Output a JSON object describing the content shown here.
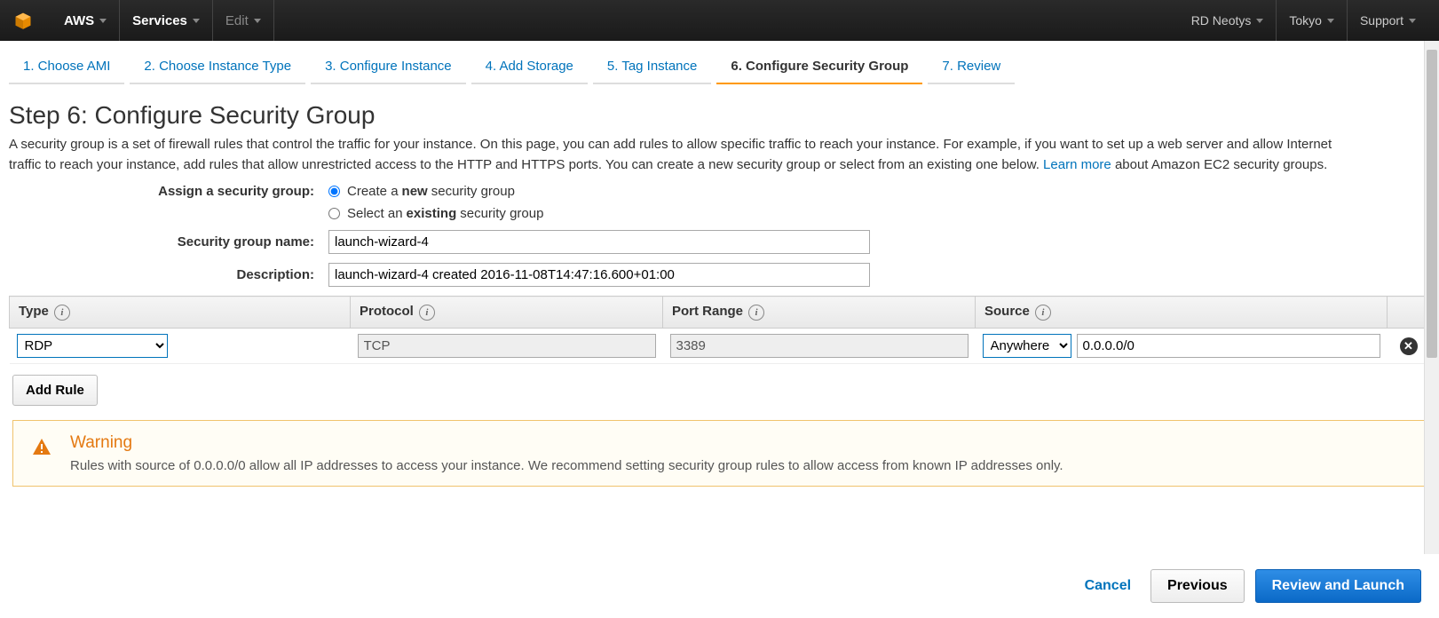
{
  "topnav": {
    "aws": "AWS",
    "services": "Services",
    "edit": "Edit",
    "account": "RD Neotys",
    "region": "Tokyo",
    "support": "Support"
  },
  "wizard": {
    "tabs": [
      "1. Choose AMI",
      "2. Choose Instance Type",
      "3. Configure Instance",
      "4. Add Storage",
      "5. Tag Instance",
      "6. Configure Security Group",
      "7. Review"
    ]
  },
  "page": {
    "title": "Step 6: Configure Security Group",
    "desc_pre": "A security group is a set of firewall rules that control the traffic for your instance. On this page, you can add rules to allow specific traffic to reach your instance. For example, if you want to set up a web server and allow Internet traffic to reach your instance, add rules that allow unrestricted access to the HTTP and HTTPS ports. You can create a new security group or select from an existing one below. ",
    "learn_more": "Learn more",
    "desc_post": " about Amazon EC2 security groups."
  },
  "form": {
    "assign_label": "Assign a security group:",
    "option_new_pre": "Create a ",
    "option_new_bold": "new",
    "option_new_post": " security group",
    "option_existing_pre": "Select an ",
    "option_existing_bold": "existing",
    "option_existing_post": " security group",
    "name_label": "Security group name:",
    "name_value": "launch-wizard-4",
    "desc_label": "Description:",
    "desc_value": "launch-wizard-4 created 2016-11-08T14:47:16.600+01:00"
  },
  "table": {
    "headers": {
      "type": "Type",
      "protocol": "Protocol",
      "port": "Port Range",
      "source": "Source"
    },
    "rows": [
      {
        "type": "RDP",
        "protocol": "TCP",
        "port": "3389",
        "source_opt": "Anywhere",
        "source_ip": "0.0.0.0/0"
      }
    ],
    "add_rule": "Add Rule"
  },
  "warning": {
    "title": "Warning",
    "text": "Rules with source of 0.0.0.0/0 allow all IP addresses to access your instance. We recommend setting security group rules to allow access from known IP addresses only."
  },
  "footer": {
    "cancel": "Cancel",
    "previous": "Previous",
    "review": "Review and Launch"
  }
}
